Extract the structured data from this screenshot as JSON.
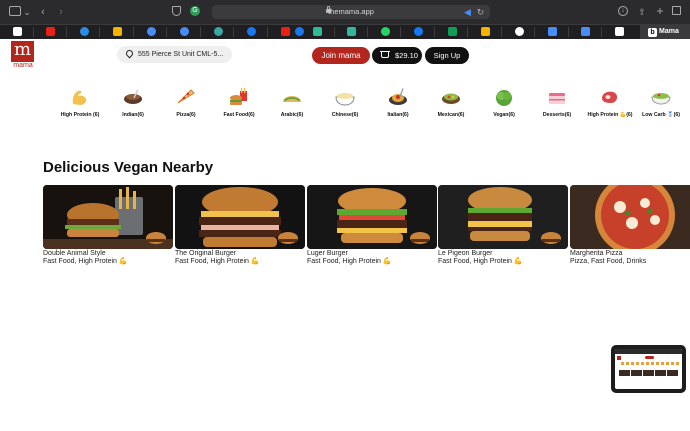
{
  "browser": {
    "url": "themama.app",
    "bitly_tab_label": "Mama"
  },
  "header": {
    "logo_letter": "m",
    "logo_text": "mama",
    "address": "555 Pierce St Unit CML-5...",
    "join_label": "Join mama",
    "cart_amount": "$29.10",
    "signup_label": "Sign Up"
  },
  "categories": [
    {
      "label": "High Protein (6)",
      "icon": "flexed-biceps-icon"
    },
    {
      "label": "Indian(6)",
      "icon": "curry-bowl-icon"
    },
    {
      "label": "Pizza(6)",
      "icon": "pizza-slice-icon"
    },
    {
      "label": "Fast Food(6)",
      "icon": "burger-fries-icon"
    },
    {
      "label": "Arabic(6)",
      "icon": "taco-icon"
    },
    {
      "label": "Chinese(6)",
      "icon": "dumpling-bowl-icon"
    },
    {
      "label": "Italian(6)",
      "icon": "spaghetti-icon"
    },
    {
      "label": "Mexican(6)",
      "icon": "mexican-bowl-icon"
    },
    {
      "label": "Vegan(6)",
      "icon": "lettuce-icon"
    },
    {
      "label": "Desserts(6)",
      "icon": "cake-icon"
    },
    {
      "label": "High Protein 💪(6)",
      "icon": "meat-icon"
    },
    {
      "label": "Low Carb 🥈(6)",
      "icon": "salad-bowl-icon"
    }
  ],
  "section": {
    "title": "Delicious Vegan Nearby"
  },
  "items": [
    {
      "name": "Double Animal Style",
      "tags": "Fast Food, High Protein 💪"
    },
    {
      "name": "The Original Burger",
      "tags": "Fast Food, High Protein 💪"
    },
    {
      "name": "Luger Burger",
      "tags": "Fast Food, High Protein 💪"
    },
    {
      "name": "Le Pigeon Burger",
      "tags": "Fast Food, High Protein 💪"
    },
    {
      "name": "Margherita Pizza",
      "tags": "Pizza, Fast Food, Drinks"
    }
  ],
  "colors": {
    "brand": "#b3261e",
    "dark_button": "#111111"
  }
}
